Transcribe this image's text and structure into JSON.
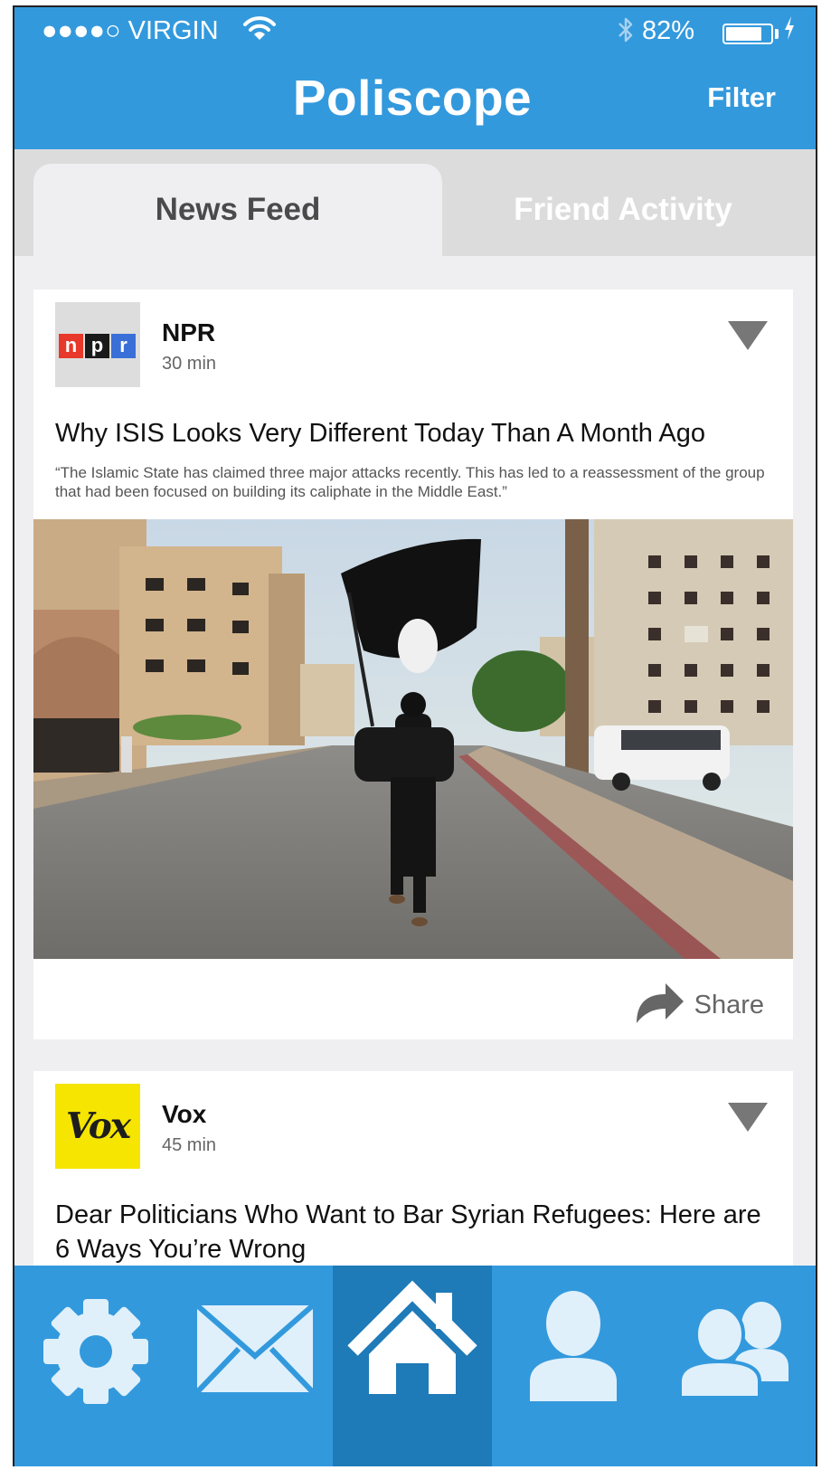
{
  "status_bar": {
    "carrier": "●●●●○ VIRGIN",
    "bluetooth_icon": "bluetooth-icon",
    "battery_percent": "82%",
    "battery_level": 0.82
  },
  "header": {
    "title": "Poliscope",
    "filter_label": "Filter"
  },
  "tabs": [
    {
      "label": "News Feed",
      "active": true
    },
    {
      "label": "Friend Activity",
      "active": false
    }
  ],
  "feed": [
    {
      "source": "NPR",
      "time": "30 min",
      "logo_letters": [
        "n",
        "p",
        "r"
      ],
      "logo_colors": [
        "#e8382b",
        "#1a1a1a",
        "#3b6fd8"
      ],
      "headline": "Why ISIS Looks Very Different Today Than A Month Ago",
      "quote": "“The Islamic State has claimed three major attacks recently. This has led to a reassessment of the group that had been focused on building its caliphate in the Middle East.”",
      "share_label": "Share"
    },
    {
      "source": "Vox",
      "time": "45 min",
      "logo_text": "Vox",
      "headline": "Dear Politicians Who Want to Bar Syrian Refugees: Here are 6 Ways You’re Wrong"
    }
  ],
  "nav": [
    {
      "icon": "gear-icon",
      "active": false
    },
    {
      "icon": "mail-icon",
      "active": false
    },
    {
      "icon": "home-icon",
      "active": true
    },
    {
      "icon": "person-icon",
      "active": false
    },
    {
      "icon": "people-icon",
      "active": false
    }
  ],
  "colors": {
    "brand_blue": "#3399dd",
    "nav_active": "#1f7ab8",
    "tab_bg": "#dcdcdc"
  }
}
